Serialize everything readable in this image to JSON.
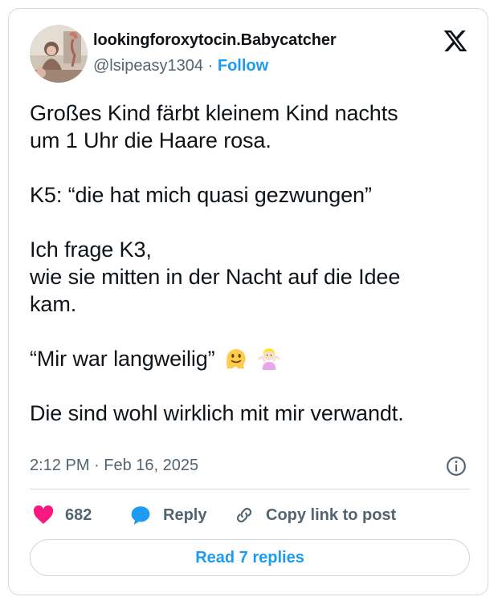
{
  "author": {
    "display_name": "lookingforoxytocin.Babycatcher",
    "handle": "@lsipeasy1304",
    "separator": "·",
    "follow_label": "Follow"
  },
  "tweet": {
    "paragraphs": [
      [
        "Großes Kind färbt kleinem Kind nachts",
        "um 1 Uhr die Haare rosa."
      ],
      [
        "K5: “die hat mich quasi gezwungen”"
      ],
      [
        "Ich frage K3,",
        "wie sie mitten in der Nacht auf die Idee",
        "kam."
      ],
      [
        "“Mir war langweilig”"
      ],
      [
        "Die sind wohl wirklich mit mir verwandt."
      ]
    ],
    "emojis": [
      "melting-face-emoji",
      "person-shrugging-emoji"
    ],
    "timestamp": "2:12 PM · Feb 16, 2025"
  },
  "actions": {
    "like_count": "682",
    "reply_label": "Reply",
    "copy_label": "Copy link to post"
  },
  "read_replies_label": "Read 7 replies",
  "colors": {
    "accent": "#1d9bf0",
    "heart": "#f91880",
    "text": "#0f1419",
    "muted": "#536471",
    "border": "#cfd9de"
  },
  "icons": [
    "x-logo-icon",
    "info-icon",
    "heart-icon",
    "reply-bubble-icon",
    "link-icon"
  ]
}
